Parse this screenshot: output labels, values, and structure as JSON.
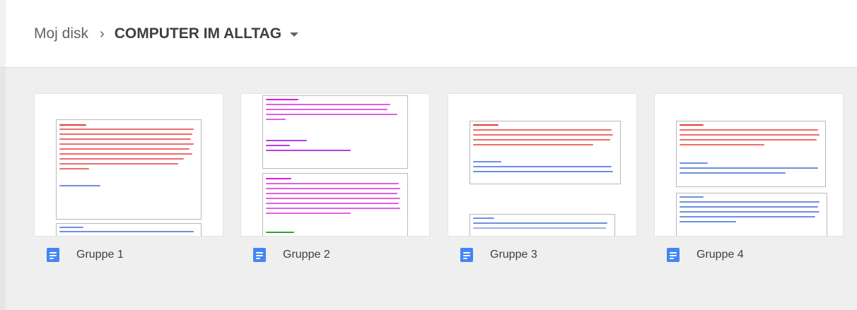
{
  "breadcrumb": {
    "root": "Moj disk",
    "separator": "›",
    "current": "COMPUTER IM ALLTAG"
  },
  "files": [
    {
      "name": "Gruppe 1",
      "icon": "google-docs-icon"
    },
    {
      "name": "Gruppe 2",
      "icon": "google-docs-icon"
    },
    {
      "name": "Gruppe 3",
      "icon": "google-docs-icon"
    },
    {
      "name": "Gruppe 4",
      "icon": "google-docs-icon"
    }
  ],
  "colors": {
    "doc_icon": "#4285f4",
    "text_red": "#e53935",
    "text_magenta": "#d81bd8",
    "text_blue": "#3f6fd8",
    "text_green": "#2e9e3e"
  }
}
